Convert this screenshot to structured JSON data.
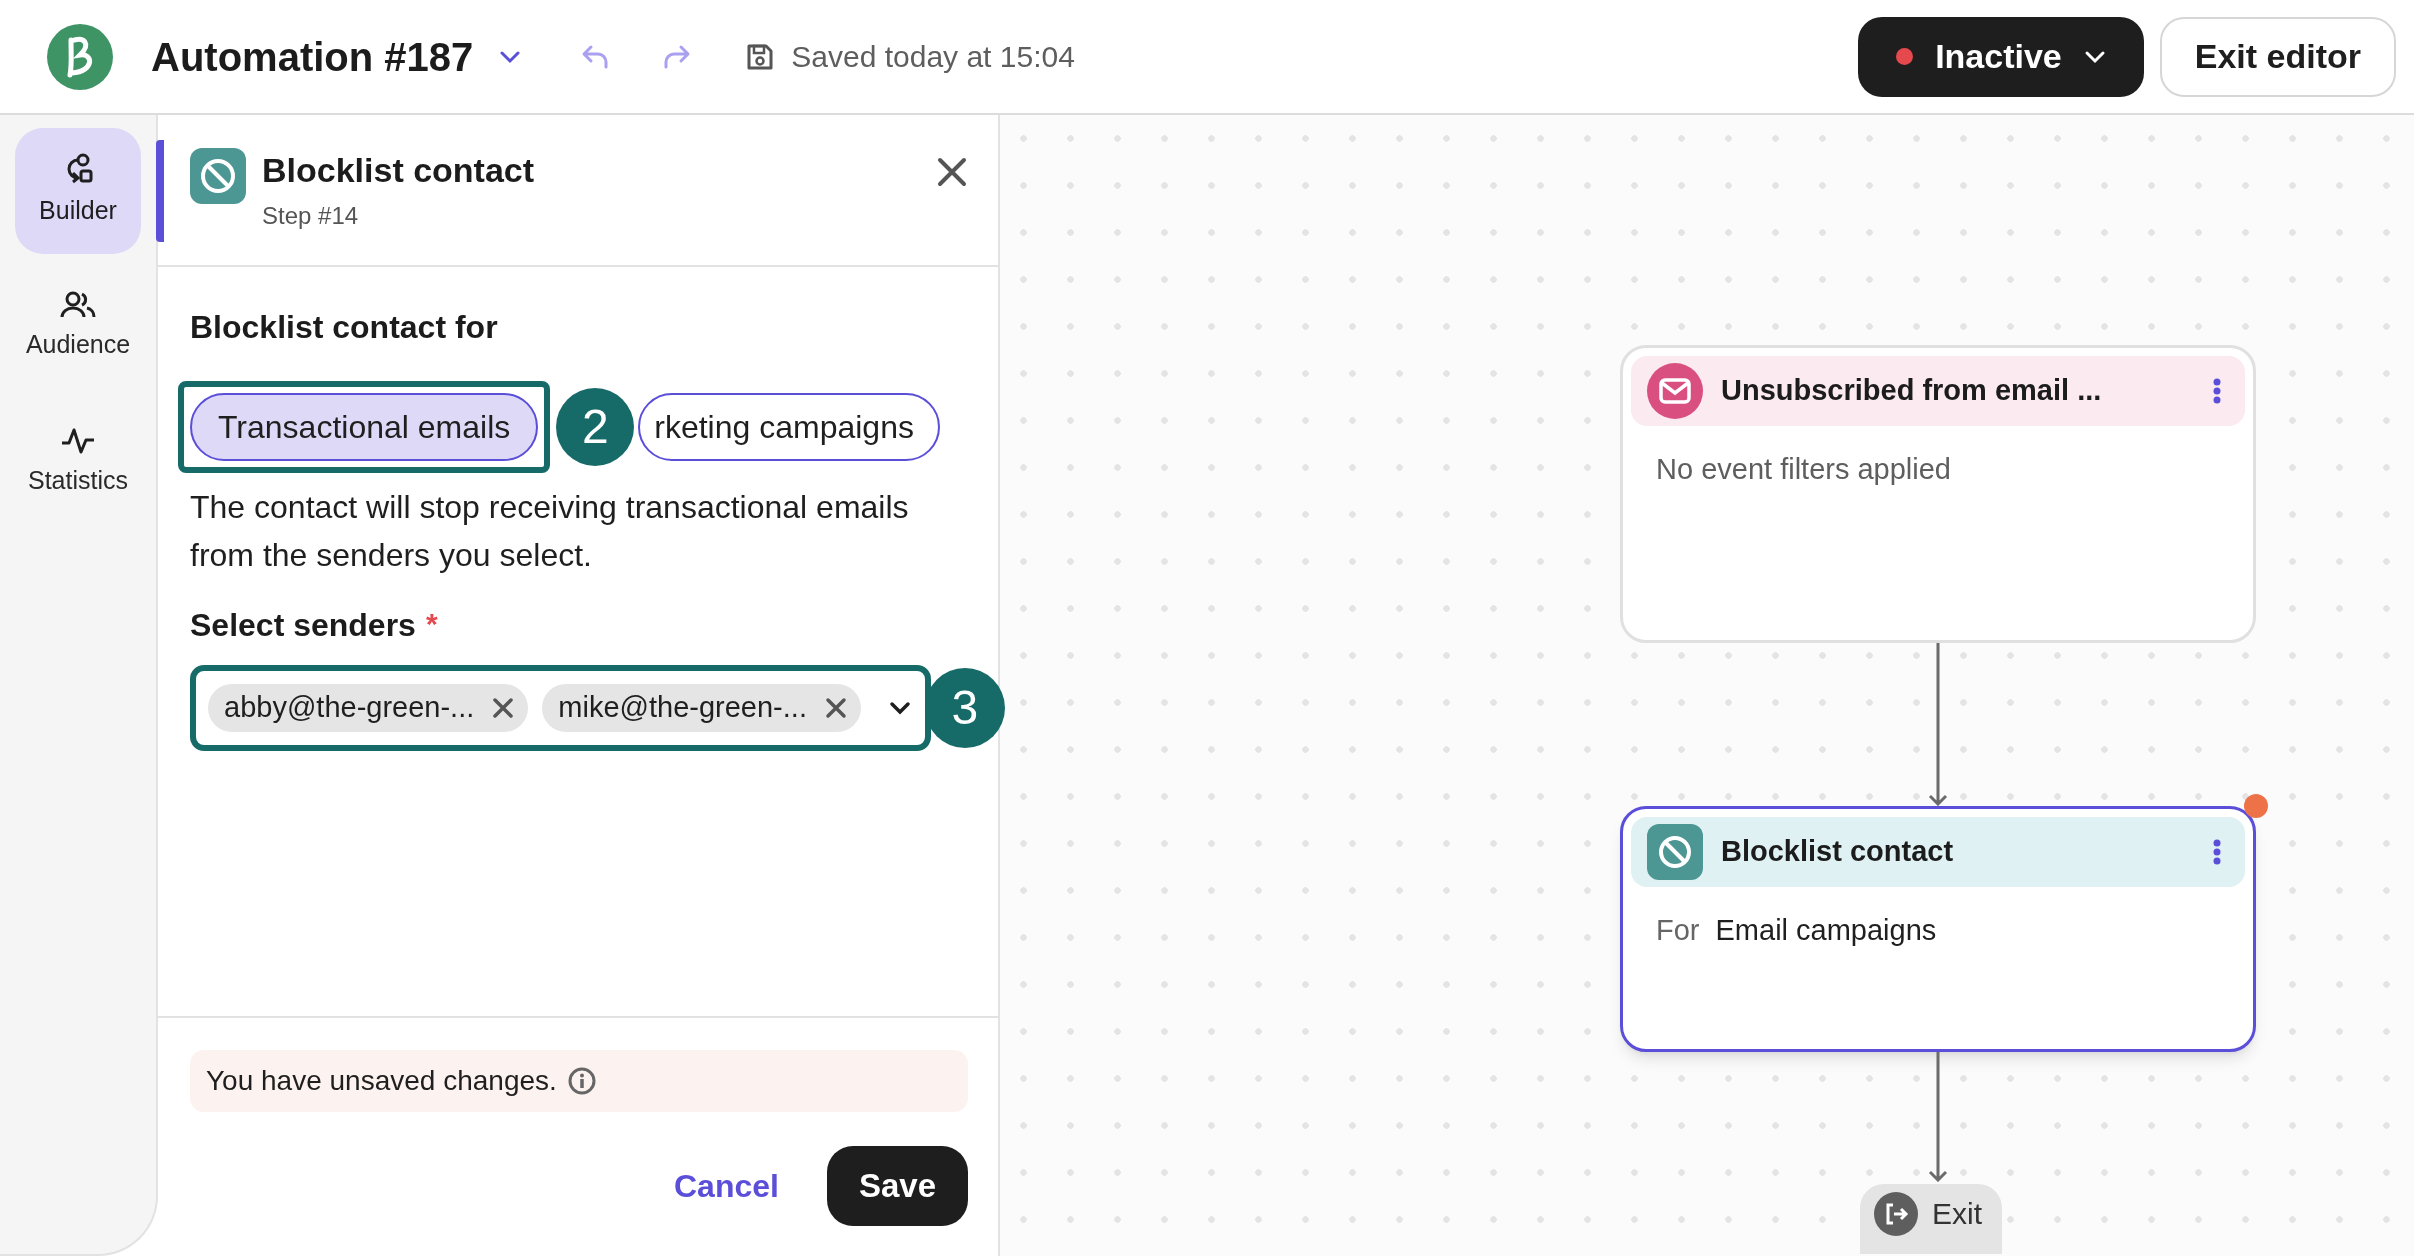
{
  "header": {
    "title": "Automation #187",
    "save_status": "Saved today at 15:04",
    "status_button": {
      "label": "Inactive",
      "color": "#e5484d"
    },
    "exit_button": "Exit editor"
  },
  "sidebar": {
    "items": [
      {
        "label": "Builder",
        "kind": "builder",
        "selected": true
      },
      {
        "label": "Audience",
        "kind": "audience",
        "selected": false
      },
      {
        "label": "Statistics",
        "kind": "statistics",
        "selected": false
      }
    ]
  },
  "panel": {
    "title": "Blocklist contact",
    "subtitle": "Step #14",
    "section_label": "Blocklist contact for",
    "options": [
      {
        "label": "Transactional emails",
        "selected": true
      },
      {
        "label": "rketing campaigns",
        "selected": false
      }
    ],
    "options_marker": "2",
    "description": "The contact will stop receiving transactional emails from the senders you select.",
    "senders_label": "Select senders",
    "required_mark": "*",
    "senders": [
      "abby@the-green-...",
      "mike@the-green-..."
    ],
    "senders_marker": "3",
    "notice": "You have unsaved changes.",
    "cancel": "Cancel",
    "save": "Save"
  },
  "canvas": {
    "nodes": [
      {
        "kind": "trigger",
        "title": "Unsubscribed from email ...",
        "body": "No event filters applied",
        "selected": false,
        "warning": false
      },
      {
        "kind": "action",
        "title": "Blocklist contact",
        "for_label": "For",
        "for_value": "Email campaigns",
        "selected": true,
        "warning": true
      }
    ],
    "exit": "Exit"
  }
}
